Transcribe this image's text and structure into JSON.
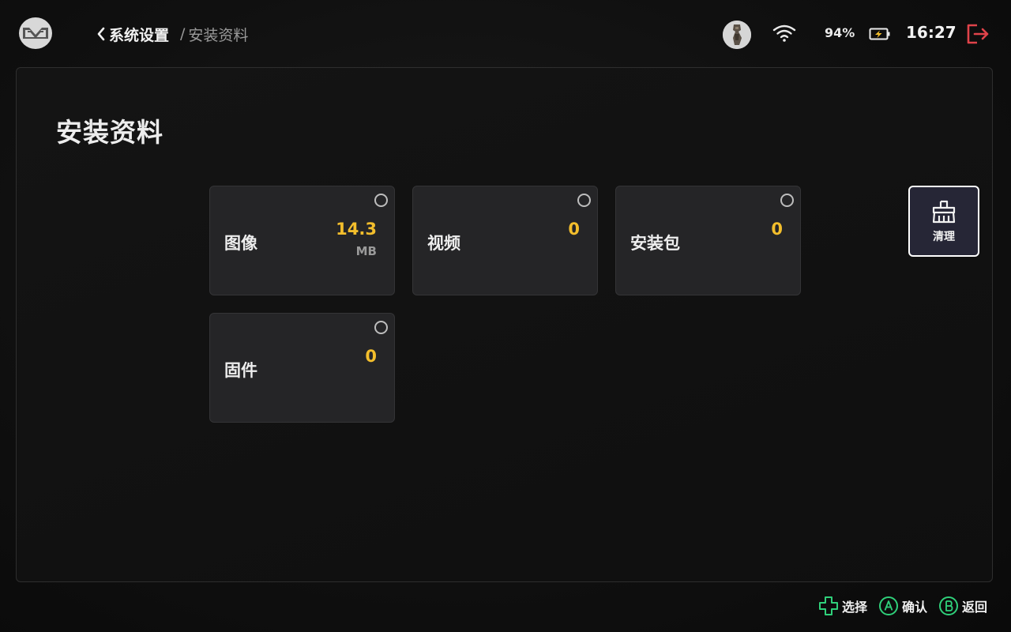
{
  "header": {
    "breadcrumb": {
      "back_label": "系统设置",
      "separator": "/",
      "current_label": "安装资料"
    },
    "status": {
      "battery_percent": "94%",
      "time": "16:27",
      "wifi_icon": "wifi-icon",
      "battery_icon": "battery-charging-icon",
      "exit_icon": "exit-icon"
    }
  },
  "page": {
    "title": "安装资料",
    "cards": [
      {
        "label": "图像",
        "value": "14.3",
        "unit": "MB",
        "selected": false
      },
      {
        "label": "视频",
        "value": "0",
        "unit": "",
        "selected": false
      },
      {
        "label": "安装包",
        "value": "0",
        "unit": "",
        "selected": false
      },
      {
        "label": "固件",
        "value": "0",
        "unit": "",
        "selected": false
      }
    ],
    "clean_button": {
      "label": "清理",
      "icon": "broom-icon"
    }
  },
  "footer": {
    "hints": [
      {
        "icon": "dpad-icon",
        "label": "选择"
      },
      {
        "icon": "a-button-icon",
        "label": "确认"
      },
      {
        "icon": "b-button-icon",
        "label": "返回"
      }
    ]
  },
  "colors": {
    "accent_value": "#f3be2c",
    "exit_red": "#e0434a",
    "hint_green": "#2fd07a",
    "card_bg": "#252527",
    "clean_btn_bg": "#262636"
  }
}
